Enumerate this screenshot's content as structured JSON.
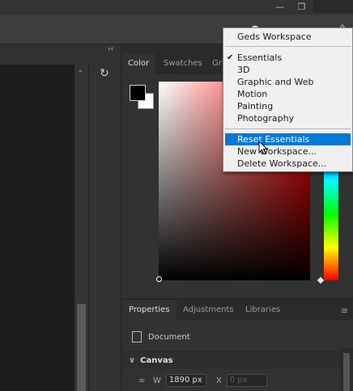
{
  "titlebar": {
    "minimize_icon": "minimize-icon",
    "restore_icon": "restore-icon"
  },
  "optionsbar": {
    "icons": [
      "search-icon",
      "workspace-icon",
      "share-icon"
    ]
  },
  "color_panel": {
    "tabs": [
      "Color",
      "Swatches",
      "Gr"
    ],
    "active_tab": "Color",
    "foreground_color": "#000000",
    "background_color": "#ffffff",
    "hue": "#ff0000"
  },
  "properties_panel": {
    "tabs": [
      "Properties",
      "Adjustments",
      "Libraries"
    ],
    "active_tab": "Properties",
    "document_label": "Document",
    "section_title": "Canvas",
    "w_label": "W",
    "w_value": "1890 px",
    "x_label": "X",
    "x_placeholder": "0 px"
  },
  "workspace_menu": {
    "top_item": "Geds Workspace",
    "presets": [
      "Essentials",
      "3D",
      "Graphic and Web",
      "Motion",
      "Painting",
      "Photography"
    ],
    "checked": "Essentials",
    "actions": [
      "Reset Essentials",
      "New Workspace...",
      "Delete Workspace..."
    ],
    "highlighted": "Reset Essentials",
    "check_mark": "✔"
  }
}
